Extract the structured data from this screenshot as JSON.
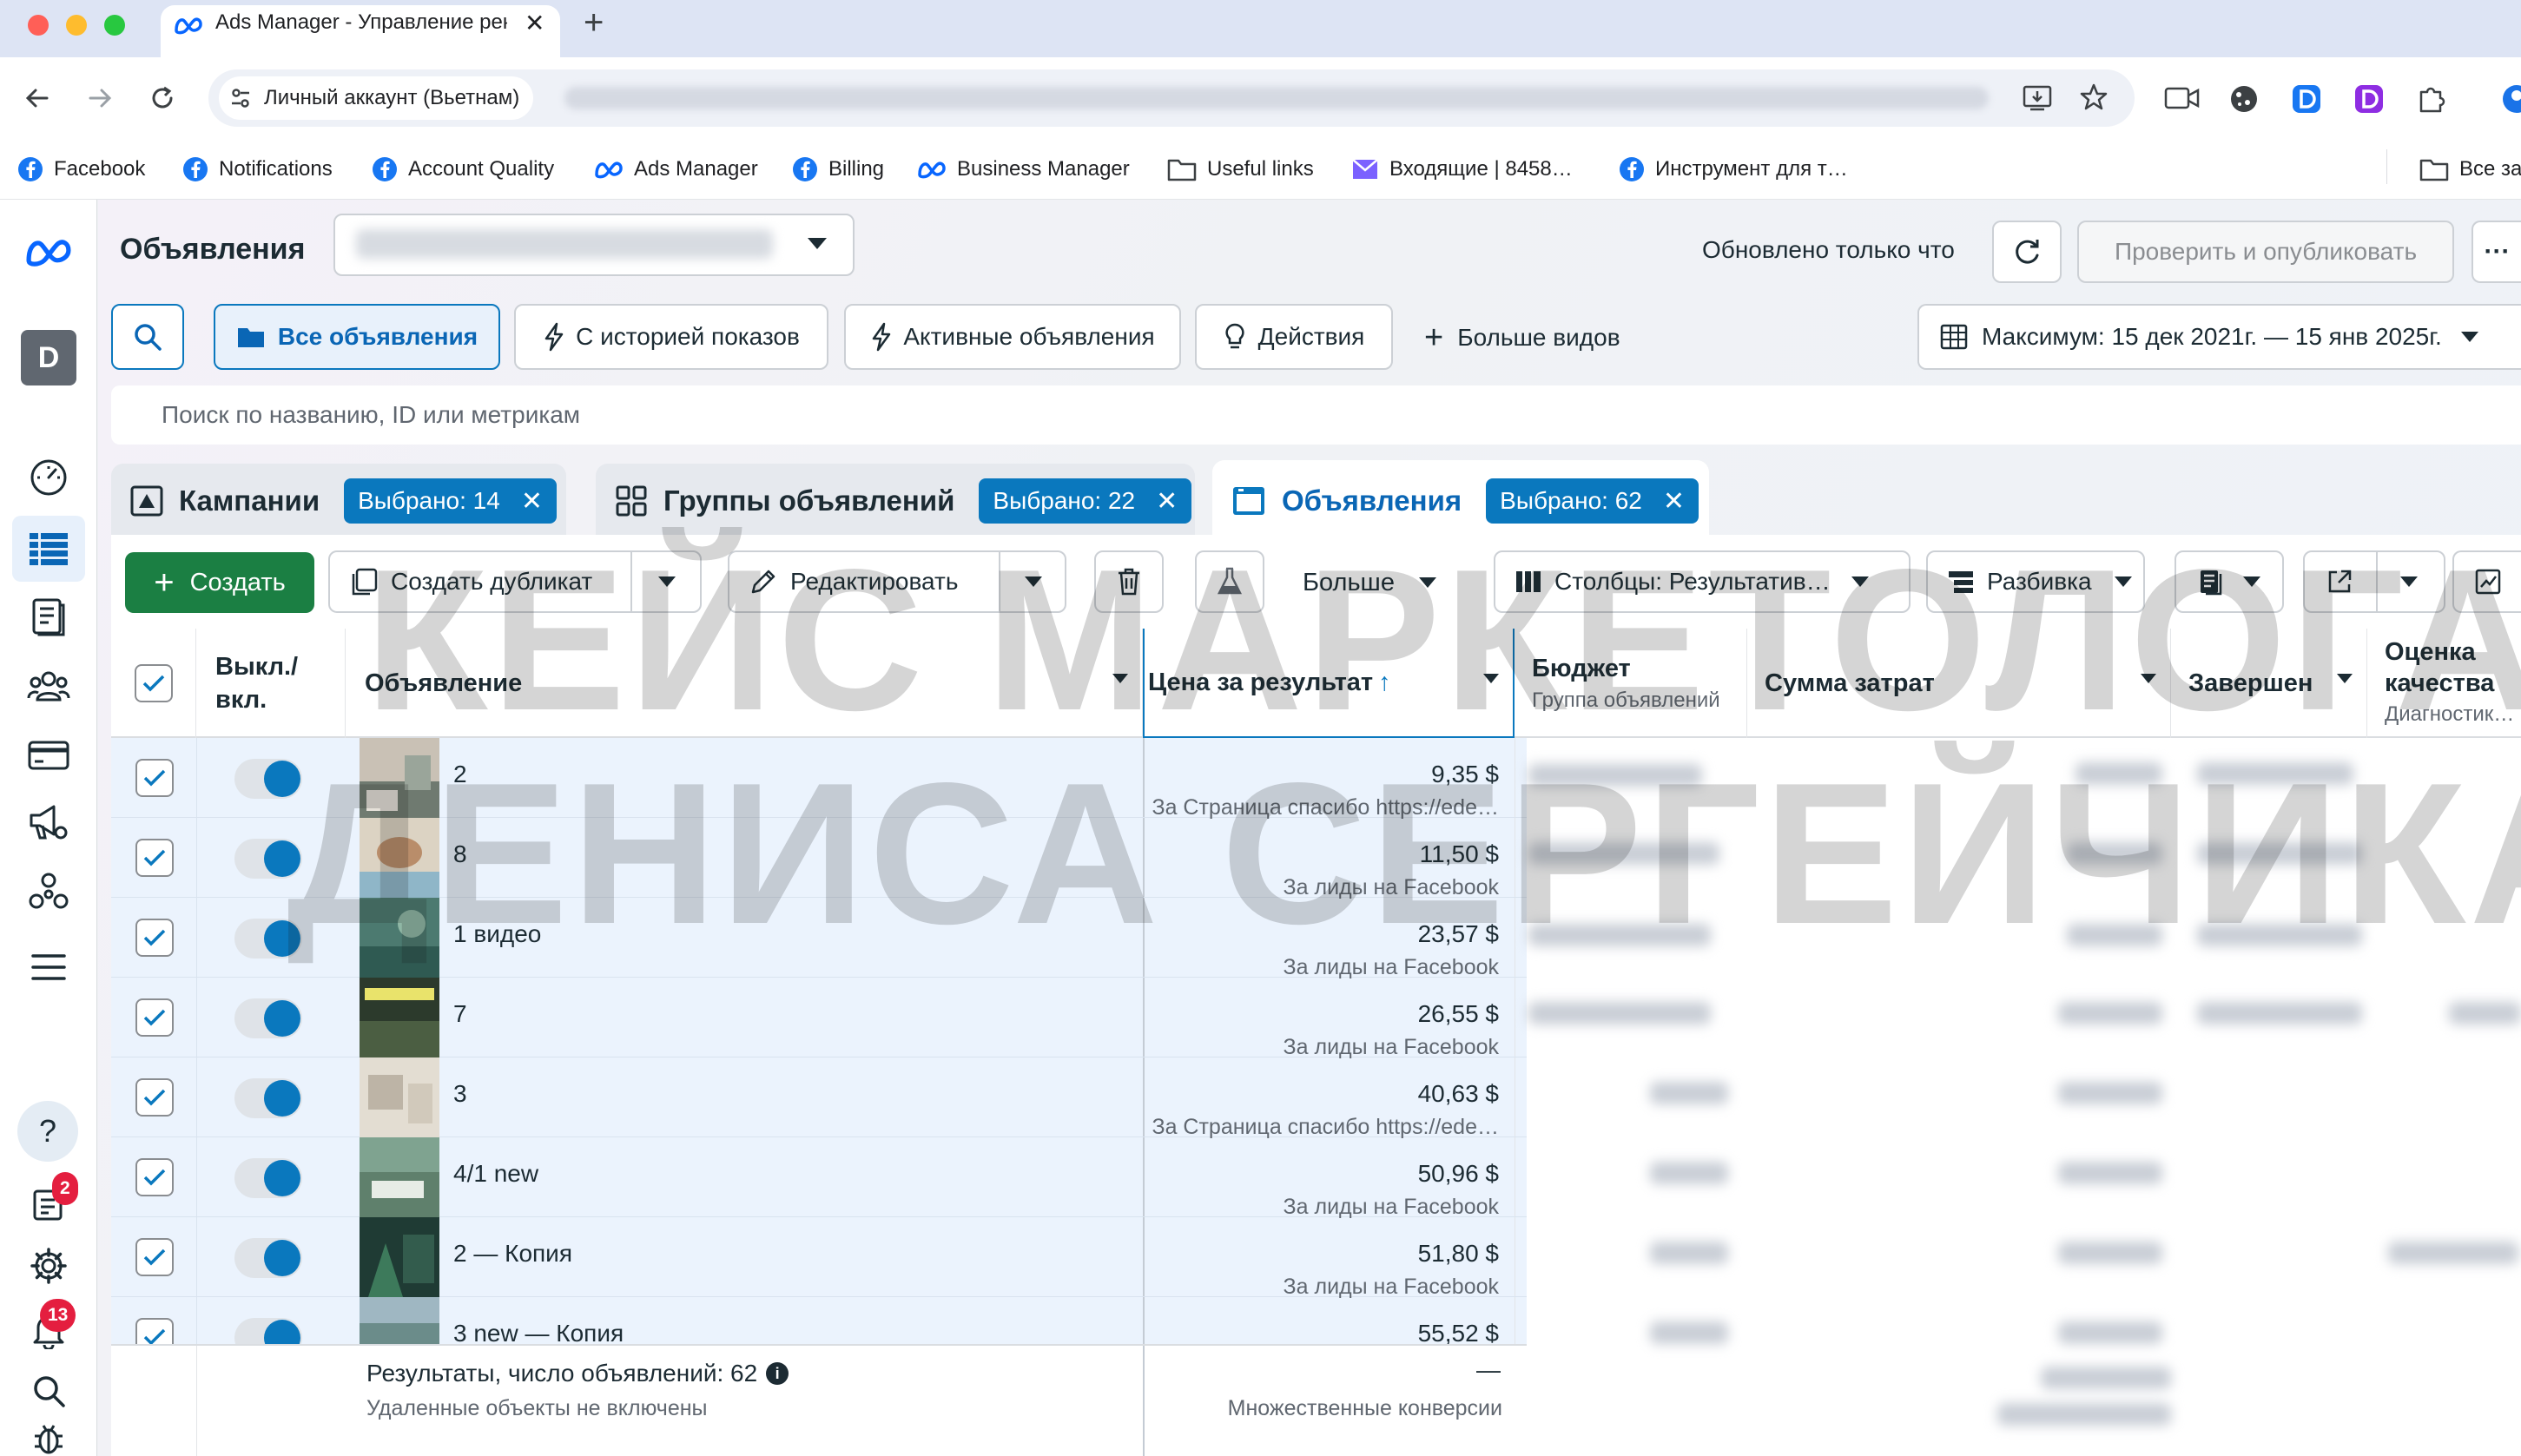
{
  "browser": {
    "tab_title": "Ads Manager - Управление рекламой",
    "new_tab": "+",
    "close_tab": "✕",
    "account_chip": "Личный аккаунт (Вьетнам)",
    "bookmarks": [
      "Facebook",
      "Notifications",
      "Account Quality",
      "Ads Manager",
      "Billing",
      "Business Manager",
      "Useful links",
      "Входящие | 8458…",
      "Инструмент для т…"
    ],
    "all_bookmarks": "Все за"
  },
  "nav": {
    "avatar_letter": "D",
    "help_label": "?",
    "notifications_badge": "2",
    "alerts_badge": "13"
  },
  "header": {
    "title": "Объявления",
    "updated": "Обновлено только что",
    "publish": "Проверить и опубликовать",
    "more": "···"
  },
  "views": {
    "all": "Все объявления",
    "history": "С историей показов",
    "active": "Активные объявления",
    "actions": "Действия",
    "more_views": "Больше видов",
    "date_range": "Максимум: 15 дек 2021г. — 15 янв 2025г."
  },
  "search": {
    "placeholder": "Поиск по названию, ID или метрикам"
  },
  "level_tabs": {
    "campaigns": "Кампании",
    "campaigns_sel": "Выбрано: 14",
    "adsets": "Группы объявлений",
    "adsets_sel": "Выбрано: 22",
    "ads": "Объявления",
    "ads_sel": "Выбрано: 62"
  },
  "toolbar": {
    "create": "Создать",
    "duplicate": "Создать дубликат",
    "edit": "Редактировать",
    "more": "Больше",
    "columns": "Столбцы: Результатив…",
    "breakdown": "Разбивка"
  },
  "columns": {
    "toggle": "Выкл./ вкл.",
    "ad": "Объявление",
    "cpr": "Цена за результат",
    "sort_arrow": "↑",
    "budget": "Бюджет",
    "budget_sub": "Группа объявлений",
    "spend": "Сумма затрат",
    "ends": "Завершен",
    "quality": "Оценка качества",
    "quality_sub": "Диагностик…"
  },
  "rows": [
    {
      "name": "2",
      "cost": "9,35 $",
      "sub": "За Страница спасибо https://ede…"
    },
    {
      "name": "8",
      "cost": "11,50 $",
      "sub": "За лиды на Facebook"
    },
    {
      "name": "1 видео",
      "cost": "23,57 $",
      "sub": "За лиды на Facebook"
    },
    {
      "name": "7",
      "cost": "26,55 $",
      "sub": "За лиды на Facebook"
    },
    {
      "name": "3",
      "cost": "40,63 $",
      "sub": "За Страница спасибо https://ede…"
    },
    {
      "name": "4/1 new",
      "cost": "50,96 $",
      "sub": "За лиды на Facebook"
    },
    {
      "name": "2 — Копия",
      "cost": "51,80 $",
      "sub": "За лиды на Facebook"
    },
    {
      "name": "3 new — Копия",
      "cost": "55,52 $",
      "sub": ""
    }
  ],
  "footer": {
    "results": "Результаты, число объявлений: 62",
    "info_icon_label": "i",
    "removed": "Удаленные объекты не включены",
    "dash": "—",
    "multi": "Множественные конверсии"
  },
  "watermark": {
    "line1": "КЕЙС МАРКЕТОЛОГА",
    "line2": "ДЕНИСА СЕРГЕЙЧИКА"
  },
  "colors": {
    "accent": "#0a78be",
    "create_green": "#1b7f43",
    "selected_row": "#ebf3fd",
    "badge_red": "#e41e3f"
  }
}
